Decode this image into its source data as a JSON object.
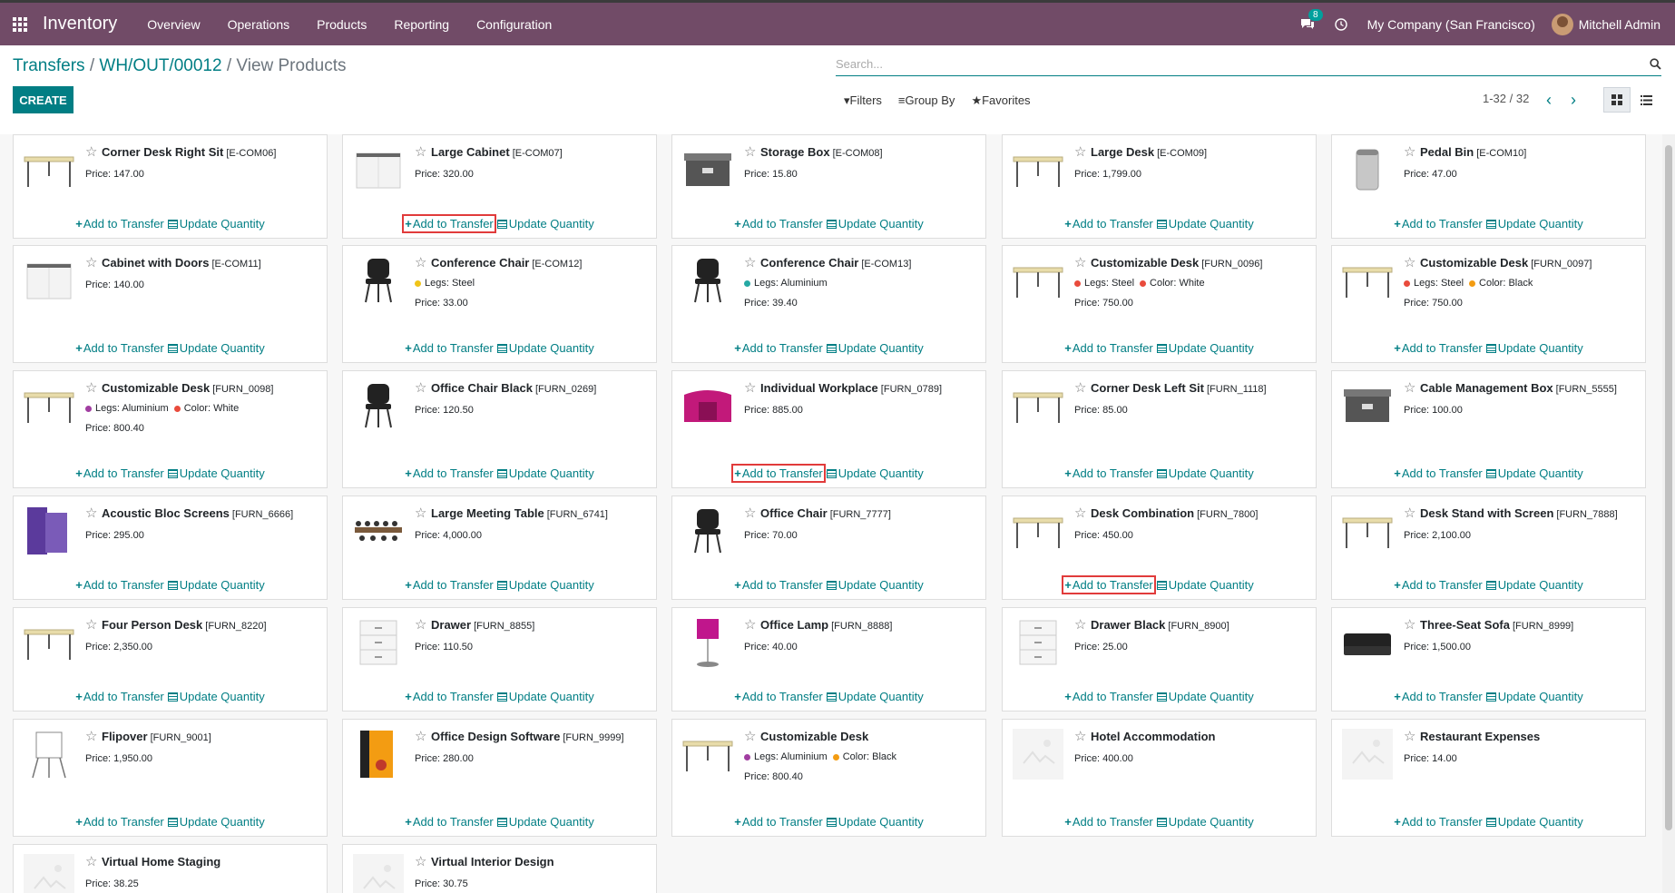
{
  "navbar": {
    "app": "Inventory",
    "menu": [
      "Overview",
      "Operations",
      "Products",
      "Reporting",
      "Configuration"
    ],
    "message_count": "8",
    "company": "My Company (San Francisco)",
    "user": "Mitchell Admin",
    "color": "#714B67"
  },
  "breadcrumb": {
    "root": "Transfers",
    "record": "WH/OUT/00012",
    "current": "View Products",
    "sep": "/"
  },
  "search": {
    "placeholder": "Search..."
  },
  "toolbar": {
    "create": "CREATE",
    "filters": "Filters",
    "group_by": "Group By",
    "favorites": "Favorites"
  },
  "pager": {
    "value": "1-32 / 32"
  },
  "labels": {
    "add_to_transfer": "Add to Transfer",
    "update_quantity": "Update Quantity"
  },
  "accent": "#017e84",
  "products": [
    {
      "name": "Corner Desk Right Sit",
      "code": "[E-COM06]",
      "price": "Price: 147.00",
      "icon": "desk-icon"
    },
    {
      "name": "Large Cabinet",
      "code": "[E-COM07]",
      "price": "Price: 320.00",
      "icon": "cabinet-icon"
    },
    {
      "name": "Storage Box",
      "code": "[E-COM08]",
      "price": "Price: 15.80",
      "icon": "box-icon"
    },
    {
      "name": "Large Desk",
      "code": "[E-COM09]",
      "price": "Price: 1,799.00",
      "icon": "desk-icon"
    },
    {
      "name": "Pedal Bin",
      "code": "[E-COM10]",
      "price": "Price: 47.00",
      "icon": "bin-icon"
    },
    {
      "name": "Cabinet with Doors",
      "code": "[E-COM11]",
      "price": "Price: 140.00",
      "icon": "cabinet-icon"
    },
    {
      "name": "Conference Chair",
      "code": "[E-COM12]",
      "price": "Price: 33.00",
      "icon": "chair-icon",
      "attrs": [
        {
          "label": "Legs: Steel",
          "color": "#f0c419"
        }
      ]
    },
    {
      "name": "Conference Chair",
      "code": "[E-COM13]",
      "price": "Price: 39.40",
      "icon": "chair-icon",
      "attrs": [
        {
          "label": "Legs: Aluminium",
          "color": "#26a9a4"
        }
      ]
    },
    {
      "name": "Customizable Desk",
      "code": "[FURN_0096]",
      "price": "Price: 750.00",
      "icon": "desk-icon",
      "attrs": [
        {
          "label": "Legs: Steel",
          "color": "#e94b3c"
        },
        {
          "label": "Color: White",
          "color": "#e94b3c"
        }
      ]
    },
    {
      "name": "Customizable Desk",
      "code": "[FURN_0097]",
      "price": "Price: 750.00",
      "icon": "desk-icon",
      "attrs": [
        {
          "label": "Legs: Steel",
          "color": "#e94b3c"
        },
        {
          "label": "Color: Black",
          "color": "#f39c12"
        }
      ]
    },
    {
      "name": "Customizable Desk",
      "code": "[FURN_0098]",
      "price": "Price: 800.40",
      "icon": "desk-icon",
      "attrs": [
        {
          "label": "Legs: Aluminium",
          "color": "#a13ea1"
        },
        {
          "label": "Color: White",
          "color": "#e94b3c"
        }
      ]
    },
    {
      "name": "Office Chair Black",
      "code": "[FURN_0269]",
      "price": "Price: 120.50",
      "icon": "chair-icon"
    },
    {
      "name": "Individual Workplace",
      "code": "[FURN_0789]",
      "price": "Price: 885.00",
      "icon": "workplace-icon"
    },
    {
      "name": "Corner Desk Left Sit",
      "code": "[FURN_1118]",
      "price": "Price: 85.00",
      "icon": "desk-icon"
    },
    {
      "name": "Cable Management Box",
      "code": "[FURN_5555]",
      "price": "Price: 100.00",
      "icon": "box-icon"
    },
    {
      "name": "Acoustic Bloc Screens",
      "code": "[FURN_6666]",
      "price": "Price: 295.00",
      "icon": "screen-icon"
    },
    {
      "name": "Large Meeting Table",
      "code": "[FURN_6741]",
      "price": "Price: 4,000.00",
      "icon": "table-icon"
    },
    {
      "name": "Office Chair",
      "code": "[FURN_7777]",
      "price": "Price: 70.00",
      "icon": "chair-icon"
    },
    {
      "name": "Desk Combination",
      "code": "[FURN_7800]",
      "price": "Price: 450.00",
      "icon": "desk-icon"
    },
    {
      "name": "Desk Stand with Screen",
      "code": "[FURN_7888]",
      "price": "Price: 2,100.00",
      "icon": "desk-icon"
    },
    {
      "name": "Four Person Desk",
      "code": "[FURN_8220]",
      "price": "Price: 2,350.00",
      "icon": "desk-icon"
    },
    {
      "name": "Drawer",
      "code": "[FURN_8855]",
      "price": "Price: 110.50",
      "icon": "drawer-icon"
    },
    {
      "name": "Office Lamp",
      "code": "[FURN_8888]",
      "price": "Price: 40.00",
      "icon": "lamp-icon"
    },
    {
      "name": "Drawer Black",
      "code": "[FURN_8900]",
      "price": "Price: 25.00",
      "icon": "drawer-icon"
    },
    {
      "name": "Three-Seat Sofa",
      "code": "[FURN_8999]",
      "price": "Price: 1,500.00",
      "icon": "sofa-icon"
    },
    {
      "name": "Flipover",
      "code": "[FURN_9001]",
      "price": "Price: 1,950.00",
      "icon": "flipchart-icon"
    },
    {
      "name": "Office Design Software",
      "code": "[FURN_9999]",
      "price": "Price: 280.00",
      "icon": "software-box-icon"
    },
    {
      "name": "Customizable Desk",
      "code": "",
      "price": "Price: 800.40",
      "icon": "desk-icon",
      "attrs": [
        {
          "label": "Legs: Aluminium",
          "color": "#a13ea1"
        },
        {
          "label": "Color: Black",
          "color": "#f39c12"
        }
      ]
    },
    {
      "name": "Hotel Accommodation",
      "code": "",
      "price": "Price: 400.00",
      "icon": "placeholder-image-icon"
    },
    {
      "name": "Restaurant Expenses",
      "code": "",
      "price": "Price: 14.00",
      "icon": "placeholder-image-icon"
    },
    {
      "name": "Virtual Home Staging",
      "code": "",
      "price": "Price: 38.25",
      "icon": "placeholder-image-icon"
    },
    {
      "name": "Virtual Interior Design",
      "code": "",
      "price": "Price: 30.75",
      "icon": "placeholder-image-icon"
    }
  ],
  "highlighted_actions": [
    1,
    12,
    18
  ]
}
